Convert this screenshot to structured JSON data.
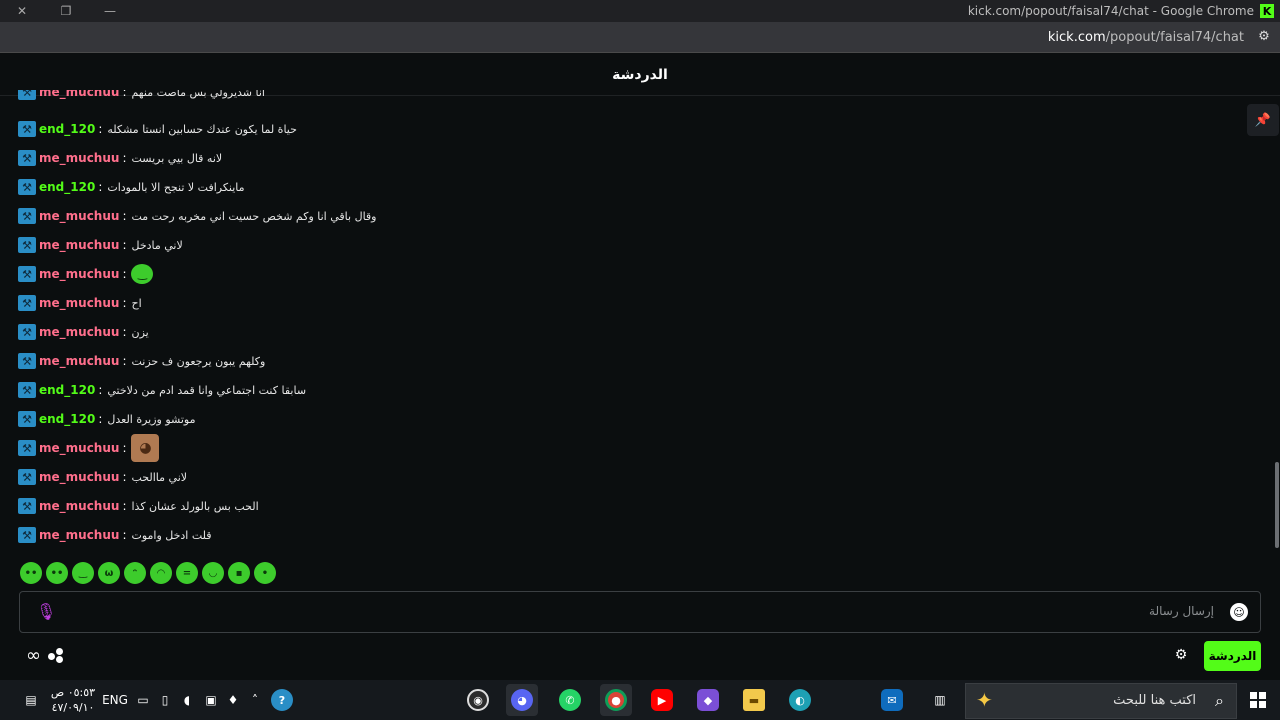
{
  "window": {
    "title": "kick.com/popout/faisal74/chat - Google Chrome",
    "close_glyph": "✕",
    "restore_glyph": "❐",
    "minimize_glyph": "—",
    "badge": "K"
  },
  "addressbar": {
    "domain": "kick.com",
    "path": "/popout/faisal74/chat"
  },
  "chat": {
    "header_title": "الدردشة",
    "input_placeholder": "إرسال رسالة",
    "chat_button": "الدردشة"
  },
  "messages": [
    {
      "user": "me_muchuu",
      "color": "pink",
      "text": "انا شديرولي بس ماصت منهم"
    },
    {
      "user": "end_120",
      "color": "green",
      "text": "حياة لما يكون عندك حسابين انستا مشكله"
    },
    {
      "user": "me_muchuu",
      "color": "pink",
      "text": "لانه قال بيي بريست"
    },
    {
      "user": "end_120",
      "color": "green",
      "text": "ماينكرافت لا تنجح الا بالمودات"
    },
    {
      "user": "me_muchuu",
      "color": "pink",
      "text": "وقال باقي انا وكم شخص حسيت اني مخربه رحت مت"
    },
    {
      "user": "me_muchuu",
      "color": "pink",
      "text": "لاني مادخل"
    },
    {
      "user": "me_muchuu",
      "color": "pink",
      "text": "",
      "emote": "green"
    },
    {
      "user": "me_muchuu",
      "color": "pink",
      "text": "اح"
    },
    {
      "user": "me_muchuu",
      "color": "pink",
      "text": "يزن"
    },
    {
      "user": "me_muchuu",
      "color": "pink",
      "text": "وكلهم يبون يرجعون ف حزنت"
    },
    {
      "user": "end_120",
      "color": "green",
      "text": "سابقا كنت اجتماعي وانا قمد ادم من دلاختي"
    },
    {
      "user": "end_120",
      "color": "green",
      "text": "موتشو وزيرة العدل"
    },
    {
      "user": "me_muchuu",
      "color": "pink",
      "text": "",
      "emote": "monkey"
    },
    {
      "user": "me_muchuu",
      "color": "pink",
      "text": "لاني ماالحب"
    },
    {
      "user": "me_muchuu",
      "color": "pink",
      "text": "الحب بس بالورلد عشان كذا"
    },
    {
      "user": "me_muchuu",
      "color": "pink",
      "text": "قلت ادخل واموت"
    }
  ],
  "taskbar": {
    "lang": "ENG",
    "time": "٠٥:٥٣ ص",
    "date": "٤٧/٠٩/١٠",
    "search_placeholder": "اكتب هنا للبحث"
  },
  "colors": {
    "kick_green": "#53fc18",
    "user_pink": "#ff6f8c",
    "badge_blue": "#2a8ec6"
  }
}
